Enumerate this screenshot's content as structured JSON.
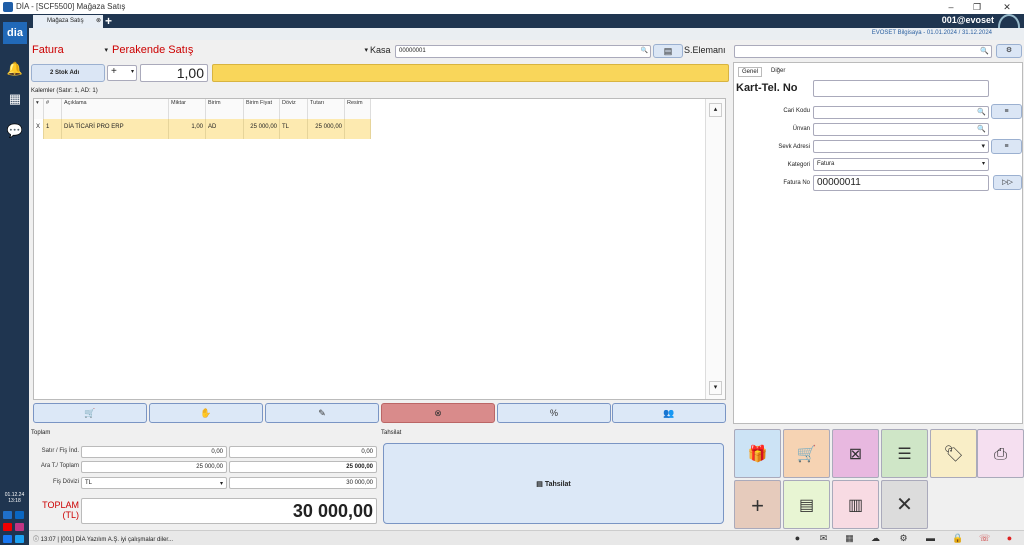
{
  "window": {
    "title": "DİA - [SCF5500] Mağaza Satış",
    "min": "–",
    "max": "❐",
    "close": "✕"
  },
  "sidebar": {
    "logo": "dia",
    "date": "01.12.24",
    "time": "13:18",
    "social_text": "dia in"
  },
  "tabbar": {
    "tab_label": "Mağaza Satış",
    "add": "+",
    "user": "001@evoset"
  },
  "subheader": {
    "info": "EVOSET Bilgisaya -  01.01.2024 / 31.12.2024"
  },
  "form": {
    "doc_type": "Fatura",
    "sale_type": "Perakende Satış",
    "kasa_label": "Kasa",
    "kasa_value": "00000001",
    "salesperson_label": "S.Elemanı",
    "stock_button": "2 Stok Adı",
    "op_symbol": "+",
    "quantity": "1,00"
  },
  "grid": {
    "summary": "Kalemler (Satır: 1,  AD: 1)",
    "columns": [
      "#",
      "Açıklama",
      "Miktar",
      "Birim",
      "Birim Fiyat",
      "Döviz",
      "Tutarı",
      "Resim"
    ],
    "rows": [
      {
        "mark": "X",
        "no": "1",
        "desc": "DİA TİCARİ PRO ERP",
        "qty": "1,00",
        "unit": "AD",
        "price": "25 000,00",
        "cur": "TL",
        "total": "25 000,00",
        "img": ""
      }
    ]
  },
  "right_panel": {
    "tabs": [
      "Genel",
      "Diğer"
    ],
    "kart_label": "Kart-Tel. No",
    "cari_label": "Cari Kodu",
    "unvan_label": "Ünvan",
    "sevk_label": "Sevk Adresi",
    "kategori_label": "Kategori",
    "kategori_value": "Fatura",
    "fatura_label": "Fatura No",
    "fatura_value": "00000011"
  },
  "totals": {
    "section": "Toplam",
    "satir_label": "Satır / Fiş İnd.",
    "satir_1": "0,00",
    "satir_2": "0,00",
    "ara_label": "Ara T./ Toplam",
    "ara_1": "25 000,00",
    "ara_2": "25 000,00",
    "doviz_label": "Fiş Dövizi",
    "doviz_value": "TL",
    "doviz_2": "30 000,00",
    "toplam_label": "TOPLAM (TL)",
    "toplam_value": "30 000,00"
  },
  "payment": {
    "section": "Tahsilat",
    "button": "Tahsilat"
  },
  "status": {
    "message": "13:07 | [001] DİA Yazılım A.Ş. iyi çalışmalar diler..."
  },
  "colors": {
    "nav": "#1f3550",
    "accent_yellow": "#f9d65a",
    "row_highlight": "#fdeab0",
    "red_text": "#c00000"
  }
}
